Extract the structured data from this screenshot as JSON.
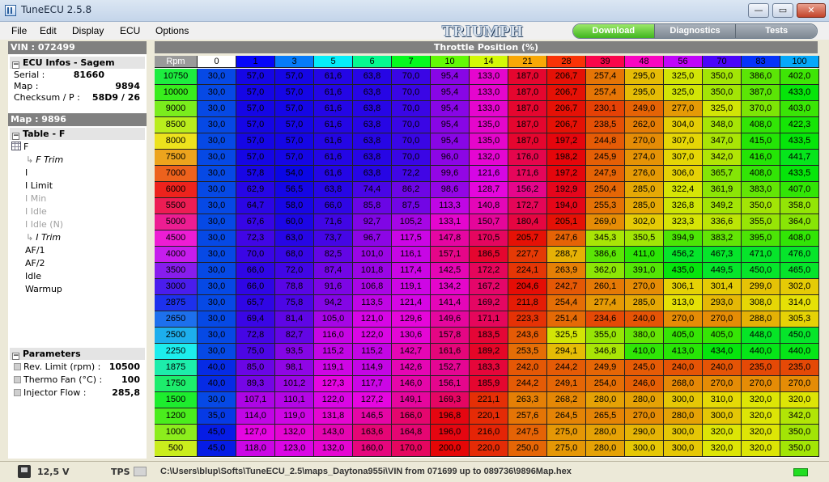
{
  "window": {
    "title": "TuneECU 2.5.8",
    "minimize": "—",
    "maximize": "▭",
    "close": "✕"
  },
  "menu": [
    "File",
    "Edit",
    "Display",
    "ECU",
    "Options"
  ],
  "brand": "TRIUMPH",
  "segments": [
    "Download",
    "Diagnostics",
    "Tests"
  ],
  "left": {
    "vin_label": "VIN : 072499",
    "ecu_header": "ECU Infos -  Sagem",
    "ecu_info": [
      {
        "k": "Serial :",
        "v": "81660"
      },
      {
        "k": "Map :",
        "v": "9894"
      },
      {
        "k": "Checksum / P :",
        "v": "58D9 / 26"
      }
    ],
    "map_label": "Map : 9896",
    "table_header": "Table - F",
    "tree": [
      {
        "label": "F"
      },
      {
        "label": "F Trim"
      },
      {
        "label": "I"
      },
      {
        "label": "I Limit"
      },
      {
        "label": "I Min"
      },
      {
        "label": "I Idle"
      },
      {
        "label": "I Idle (N)"
      },
      {
        "label": "I Trim"
      },
      {
        "label": "AF/1"
      },
      {
        "label": "AF/2"
      },
      {
        "label": "Idle"
      },
      {
        "label": "Warmup"
      }
    ],
    "params_header": "Parameters",
    "params": [
      {
        "k": "Rev. Limit (rpm) :",
        "v": "10500"
      },
      {
        "k": "Thermo Fan (°C) :",
        "v": "100"
      },
      {
        "k": "Injector Flow :",
        "v": "285,8"
      }
    ]
  },
  "main": {
    "header": "Throttle Position (%)",
    "corner": "Rpm",
    "columns": [
      "0",
      "1",
      "3",
      "5",
      "6",
      "7",
      "10",
      "14",
      "21",
      "28",
      "39",
      "48",
      "56",
      "70",
      "83",
      "100"
    ],
    "rows": [
      {
        "rpm": "10750",
        "values": [
          "30,0",
          "57,0",
          "57,0",
          "61,6",
          "63,8",
          "70,0",
          "95,4",
          "133,0",
          "187,0",
          "206,7",
          "257,4",
          "295,0",
          "325,0",
          "350,0",
          "386,0",
          "402,0"
        ]
      },
      {
        "rpm": "10000",
        "values": [
          "30,0",
          "57,0",
          "57,0",
          "61,6",
          "63,8",
          "70,0",
          "95,4",
          "133,0",
          "187,0",
          "206,7",
          "257,4",
          "295,0",
          "325,0",
          "350,0",
          "387,0",
          "433,0"
        ]
      },
      {
        "rpm": "9000",
        "values": [
          "30,0",
          "57,0",
          "57,0",
          "61,6",
          "63,8",
          "70,0",
          "95,4",
          "133,0",
          "187,0",
          "206,7",
          "230,1",
          "249,0",
          "277,0",
          "325,0",
          "370,0",
          "403,0"
        ]
      },
      {
        "rpm": "8500",
        "values": [
          "30,0",
          "57,0",
          "57,0",
          "61,6",
          "63,8",
          "70,0",
          "95,4",
          "135,0",
          "187,0",
          "206,7",
          "238,5",
          "262,0",
          "304,0",
          "348,0",
          "408,0",
          "422,3"
        ]
      },
      {
        "rpm": "8000",
        "values": [
          "30,0",
          "57,0",
          "57,0",
          "61,6",
          "63,8",
          "70,0",
          "95,4",
          "135,0",
          "187,0",
          "197,2",
          "244,8",
          "270,0",
          "307,0",
          "347,0",
          "415,0",
          "433,5"
        ]
      },
      {
        "rpm": "7500",
        "values": [
          "30,0",
          "57,0",
          "57,0",
          "61,6",
          "63,8",
          "70,0",
          "96,0",
          "132,0",
          "176,0",
          "198,2",
          "245,9",
          "274,0",
          "307,0",
          "342,0",
          "416,0",
          "441,7"
        ]
      },
      {
        "rpm": "7000",
        "values": [
          "30,0",
          "57,8",
          "54,0",
          "61,6",
          "63,8",
          "72,2",
          "99,6",
          "121,6",
          "171,6",
          "197,2",
          "247,9",
          "276,0",
          "306,0",
          "365,7",
          "408,0",
          "433,5"
        ]
      },
      {
        "rpm": "6000",
        "values": [
          "30,0",
          "62,9",
          "56,5",
          "63,8",
          "74,4",
          "86,2",
          "98,6",
          "128,7",
          "156,2",
          "192,9",
          "250,4",
          "285,0",
          "322,4",
          "361,9",
          "383,0",
          "407,0"
        ]
      },
      {
        "rpm": "5500",
        "values": [
          "30,0",
          "64,7",
          "58,0",
          "66,0",
          "85,8",
          "87,5",
          "113,3",
          "140,8",
          "172,7",
          "194,0",
          "255,3",
          "285,0",
          "326,8",
          "349,2",
          "350,0",
          "358,0"
        ]
      },
      {
        "rpm": "5000",
        "values": [
          "30,0",
          "67,6",
          "60,0",
          "71,6",
          "92,7",
          "105,2",
          "133,1",
          "150,7",
          "180,4",
          "205,1",
          "269,0",
          "302,0",
          "323,3",
          "336,6",
          "355,0",
          "364,0"
        ]
      },
      {
        "rpm": "4500",
        "values": [
          "30,0",
          "72,3",
          "63,0",
          "73,7",
          "96,7",
          "117,5",
          "147,8",
          "170,5",
          "205,7",
          "247,6",
          "345,3",
          "350,5",
          "394,9",
          "383,2",
          "395,0",
          "408,0"
        ]
      },
      {
        "rpm": "4000",
        "values": [
          "30,0",
          "70,0",
          "68,0",
          "82,5",
          "101,0",
          "116,1",
          "157,1",
          "186,5",
          "227,7",
          "288,7",
          "386,6",
          "411,0",
          "456,2",
          "467,3",
          "471,0",
          "476,0"
        ]
      },
      {
        "rpm": "3500",
        "values": [
          "30,0",
          "66,0",
          "72,0",
          "87,4",
          "101,8",
          "117,4",
          "142,5",
          "172,2",
          "224,1",
          "263,9",
          "362,0",
          "391,0",
          "435,0",
          "449,5",
          "450,0",
          "465,0"
        ]
      },
      {
        "rpm": "3000",
        "values": [
          "30,0",
          "66,0",
          "78,8",
          "91,6",
          "106,8",
          "119,1",
          "134,2",
          "167,2",
          "204,6",
          "242,7",
          "260,1",
          "270,0",
          "306,1",
          "301,4",
          "299,0",
          "302,0"
        ]
      },
      {
        "rpm": "2875",
        "values": [
          "30,0",
          "65,7",
          "75,8",
          "94,2",
          "113,5",
          "121,4",
          "141,4",
          "169,2",
          "211,8",
          "254,4",
          "277,4",
          "285,0",
          "313,0",
          "293,0",
          "308,0",
          "314,0"
        ]
      },
      {
        "rpm": "2650",
        "values": [
          "30,0",
          "69,4",
          "81,4",
          "105,0",
          "121,0",
          "129,6",
          "149,6",
          "171,1",
          "223,3",
          "251,4",
          "234,6",
          "240,0",
          "270,0",
          "270,0",
          "288,0",
          "305,3"
        ]
      },
      {
        "rpm": "2500",
        "values": [
          "30,0",
          "72,8",
          "82,7",
          "116,0",
          "122,0",
          "130,6",
          "157,8",
          "183,5",
          "243,6",
          "325,5",
          "355,0",
          "380,0",
          "405,0",
          "405,0",
          "448,0",
          "450,0"
        ]
      },
      {
        "rpm": "2250",
        "values": [
          "30,0",
          "75,0",
          "93,5",
          "115,2",
          "115,2",
          "142,7",
          "161,6",
          "189,2",
          "253,5",
          "294,1",
          "346,8",
          "410,0",
          "413,0",
          "434,0",
          "440,0",
          "440,0"
        ]
      },
      {
        "rpm": "1875",
        "values": [
          "40,0",
          "85,0",
          "98,1",
          "119,1",
          "114,9",
          "142,6",
          "152,7",
          "183,3",
          "242,0",
          "244,2",
          "249,9",
          "245,0",
          "240,0",
          "240,0",
          "235,0",
          "235,0"
        ]
      },
      {
        "rpm": "1750",
        "values": [
          "40,0",
          "89,3",
          "101,2",
          "127,3",
          "117,7",
          "146,0",
          "156,1",
          "185,9",
          "244,2",
          "249,1",
          "254,0",
          "246,0",
          "268,0",
          "270,0",
          "270,0",
          "270,0"
        ]
      },
      {
        "rpm": "1500",
        "values": [
          "30,0",
          "107,1",
          "110,1",
          "122,0",
          "127,2",
          "149,1",
          "169,3",
          "221,1",
          "263,3",
          "268,2",
          "280,0",
          "280,0",
          "300,0",
          "310,0",
          "320,0",
          "320,0"
        ]
      },
      {
        "rpm": "1200",
        "values": [
          "35,0",
          "114,0",
          "119,0",
          "131,8",
          "146,5",
          "166,0",
          "196,8",
          "220,1",
          "257,6",
          "264,5",
          "265,5",
          "270,0",
          "280,0",
          "300,0",
          "320,0",
          "342,0"
        ]
      },
      {
        "rpm": "1000",
        "values": [
          "45,0",
          "127,0",
          "132,0",
          "143,0",
          "163,6",
          "164,8",
          "196,0",
          "216,0",
          "247,5",
          "275,0",
          "280,0",
          "290,0",
          "300,0",
          "320,0",
          "320,0",
          "350,0"
        ]
      },
      {
        "rpm": "500",
        "values": [
          "45,0",
          "118,0",
          "123,0",
          "132,0",
          "160,0",
          "170,0",
          "200,0",
          "220,0",
          "250,0",
          "275,0",
          "280,0",
          "300,0",
          "300,0",
          "320,0",
          "320,0",
          "350,0"
        ]
      }
    ]
  },
  "status": {
    "voltage": "12,5 V",
    "tps": "TPS",
    "file_path": "C:\\Users\\blup\\Softs\\TuneECU_2.5\\maps_Daytona955i\\VIN from 071699 up to 089736\\9896Map.hex"
  },
  "colors": {
    "accent_green": "#40b51f",
    "header_gray": "#808080",
    "led": "#22dd22"
  }
}
